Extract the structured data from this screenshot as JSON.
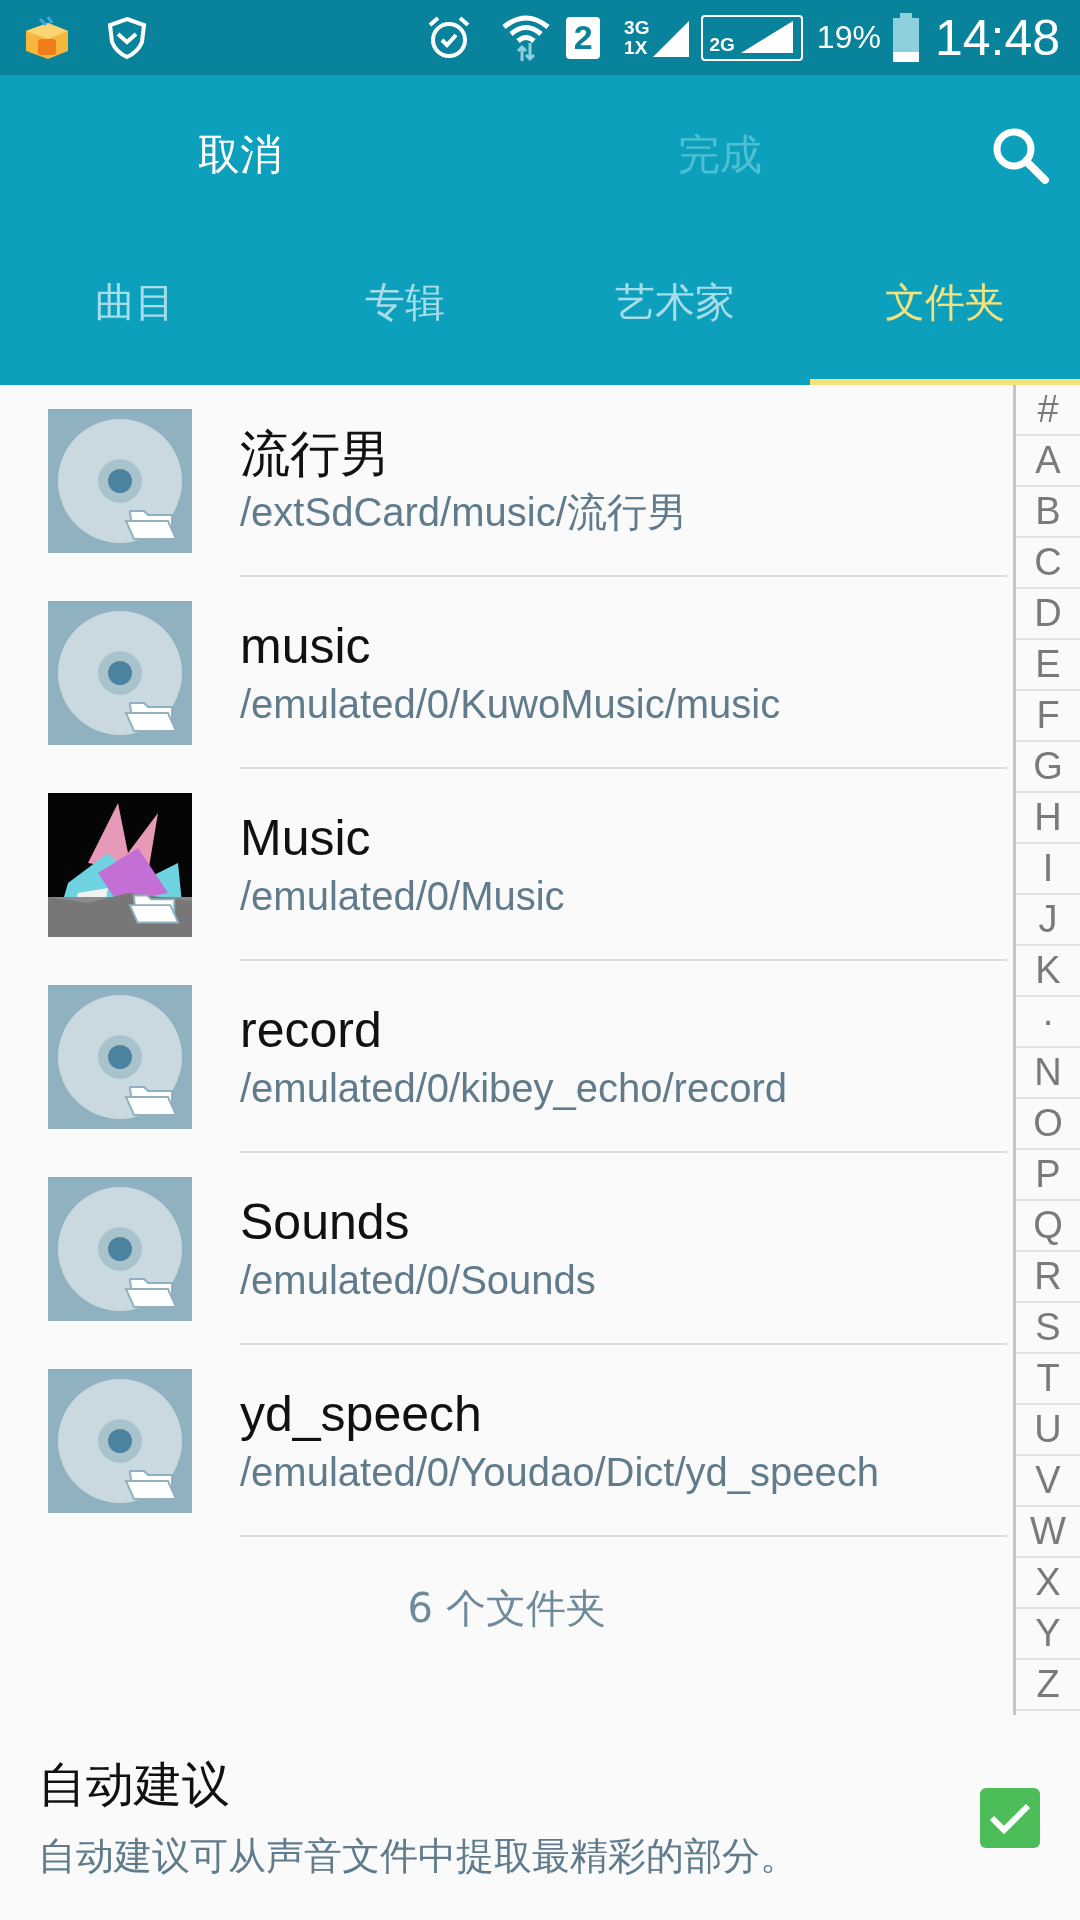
{
  "status_bar": {
    "sim": "2",
    "network_top": "3G",
    "network_bottom": "1X",
    "network_second": "2G",
    "battery": "19%",
    "time": "14:48"
  },
  "actions": {
    "cancel": {
      "label": "取消",
      "disabled": false
    },
    "done": {
      "label": "完成",
      "disabled": true
    }
  },
  "tabs": [
    {
      "label": "曲目",
      "selected": false
    },
    {
      "label": "专辑",
      "selected": false
    },
    {
      "label": "艺术家",
      "selected": false
    },
    {
      "label": "文件夹",
      "selected": true
    }
  ],
  "folders": [
    {
      "name": "流行男",
      "path": "/extSdCard/music/流行男",
      "kind": "disc"
    },
    {
      "name": "music",
      "path": "/emulated/0/KuwoMusic/music",
      "kind": "disc"
    },
    {
      "name": "Music",
      "path": "/emulated/0/Music",
      "kind": "picture"
    },
    {
      "name": "record",
      "path": "/emulated/0/kibey_echo/record",
      "kind": "disc"
    },
    {
      "name": "Sounds",
      "path": "/emulated/0/Sounds",
      "kind": "disc"
    },
    {
      "name": "yd_speech",
      "path": "/emulated/0/Youdao/Dict/yd_speech",
      "kind": "disc"
    }
  ],
  "folder_count": "6 个文件夹",
  "index_letters": [
    "#",
    "A",
    "B",
    "C",
    "D",
    "E",
    "F",
    "G",
    "H",
    "I",
    "J",
    "K",
    "·",
    "N",
    "O",
    "P",
    "Q",
    "R",
    "S",
    "T",
    "U",
    "V",
    "W",
    "X",
    "Y",
    "Z"
  ],
  "auto_suggest": {
    "title": "自动建议",
    "description": "自动建议可从声音文件中提取最精彩的部分。",
    "checked": true
  }
}
